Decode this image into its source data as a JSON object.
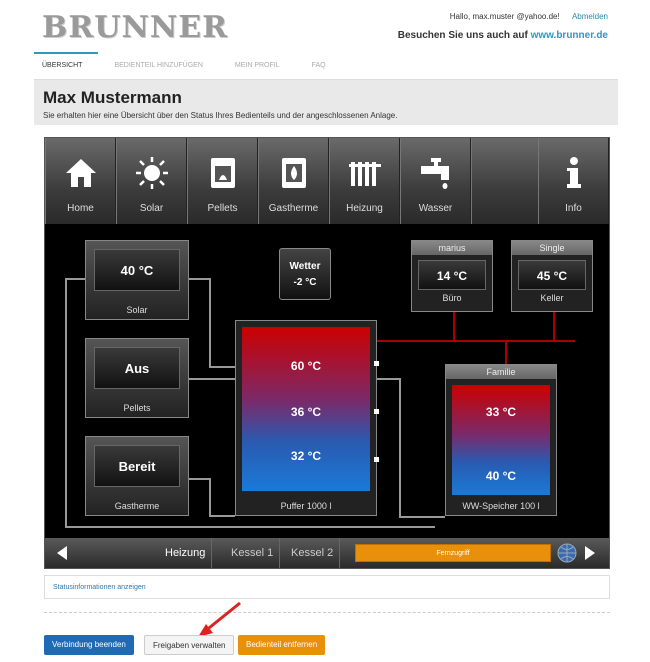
{
  "header": {
    "logo": "BRUNNER",
    "greeting": "Hallo,",
    "user": "max.muster @yahoo.de!",
    "logout": "Abmelden",
    "visit": "Besuchen Sie uns auch auf",
    "visit_url": "www.brunner.de"
  },
  "nav": [
    "ÜBERSICHT",
    "BEDIENTEIL HINZUFÜGEN",
    "MEIN PROFIL",
    "FAQ"
  ],
  "title": "Max Mustermann",
  "subtitle": "Sie erhalten hier eine Übersicht über den Status Ihres Bedienteils und der angeschlossenen Anlage.",
  "iconbar": [
    "Home",
    "Solar",
    "Pellets",
    "Gastherme",
    "Heizung",
    "Wasser",
    "Info"
  ],
  "sources": [
    {
      "value": "40 °C",
      "name": "Solar"
    },
    {
      "value": "Aus",
      "name": "Pellets"
    },
    {
      "value": "Bereit",
      "name": "Gastherme"
    }
  ],
  "wetter": {
    "label": "Wetter",
    "value": "-2 °C"
  },
  "rooms": [
    {
      "header": "marius",
      "value": "14 °C",
      "name": "Büro"
    },
    {
      "header": "Single",
      "value": "45 °C",
      "name": "Keller"
    }
  ],
  "puffer": {
    "name": "Puffer 1000 l",
    "temps": [
      "60 °C",
      "36 °C",
      "32 °C"
    ]
  },
  "speicher": {
    "header": "Familie",
    "name": "WW-Speicher 100 l",
    "temps": [
      "33 °C",
      "40 °C"
    ]
  },
  "bottom_tabs": [
    "Heizung",
    "Kessel 1",
    "Kessel 2"
  ],
  "fernzugriff": "Fernzugriff",
  "status_link": "Statusinformationen anzeigen",
  "buttons": {
    "end": "Verbindung beenden",
    "share": "Freigaben verwalten",
    "remove": "Bedienteil entfernen"
  }
}
